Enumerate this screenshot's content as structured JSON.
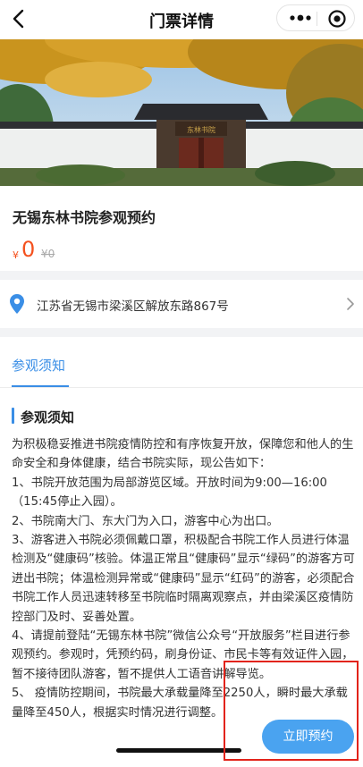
{
  "navbar": {
    "title": "门票详情"
  },
  "place": {
    "name": "无锡东林书院参观预约",
    "price_symbol": "¥",
    "price": "0",
    "original_price": "¥0",
    "address": "江苏省无锡市梁溪区解放东路867号"
  },
  "hero_sign": "东林书院",
  "tabs": [
    {
      "label": "参观须知",
      "active": true
    }
  ],
  "notice": {
    "title": "参观须知",
    "paragraphs": [
      "为积极稳妥推进书院疫情防控和有序恢复开放，保障您和他人的生命安全和身体健康，结合书院实际，现公告如下：",
      "1、书院开放范围为局部游览区域。开放时间为9:00—16:00（15:45停止入园）。",
      "2、书院南大门、东大门为入口，游客中心为出口。",
      "3、游客进入书院必须佩戴口罩，积极配合书院工作人员进行体温检测及“健康码”核验。体温正常且“健康码”显示“绿码”的游客方可进出书院；体温检测异常或“健康码”显示“红码”的游客，必须配合书院工作人员迅速转移至书院临时隔离观察点，并由梁溪区疫情防控部门及时、妥善处置。",
      "4、请提前登陆“无锡东林书院”微信公众号“开放服务”栏目进行参观预约。参观时，凭预约码，刷身份证、市民卡等有效证件入园，暂不接待团队游客，暂不提供人工语音讲解导览。",
      "5、 疫情防控期间，书院最大承载量降至2250人，瞬时最大承载量降至450人，根据实时情况进行调整。"
    ]
  },
  "actions": {
    "book_label": "立即预约"
  },
  "colors": {
    "accent": "#3a8ee6",
    "price": "#f4511e",
    "button": "#4aa3f0",
    "highlight": "#e2231a"
  },
  "icons": [
    "back-arrow-icon",
    "more-dots-icon",
    "target-icon",
    "location-pin-icon",
    "chevron-right-icon"
  ]
}
